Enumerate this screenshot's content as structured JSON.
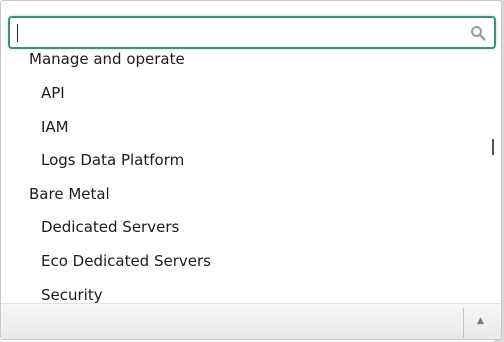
{
  "search": {
    "value": "",
    "icon": "search-icon"
  },
  "list": {
    "items": [
      {
        "label": "Manage and operate",
        "level": "group"
      },
      {
        "label": "API",
        "level": "child"
      },
      {
        "label": "IAM",
        "level": "child"
      },
      {
        "label": "Logs Data Platform",
        "level": "child"
      },
      {
        "label": "Bare Metal",
        "level": "group"
      },
      {
        "label": "Dedicated Servers",
        "level": "child"
      },
      {
        "label": "Eco Dedicated Servers",
        "level": "child"
      },
      {
        "label": "Security",
        "level": "child"
      }
    ]
  },
  "footer": {
    "arrow": "▲"
  },
  "colors": {
    "focus_border": "#3f8f80",
    "text": "#1c1c1c"
  }
}
